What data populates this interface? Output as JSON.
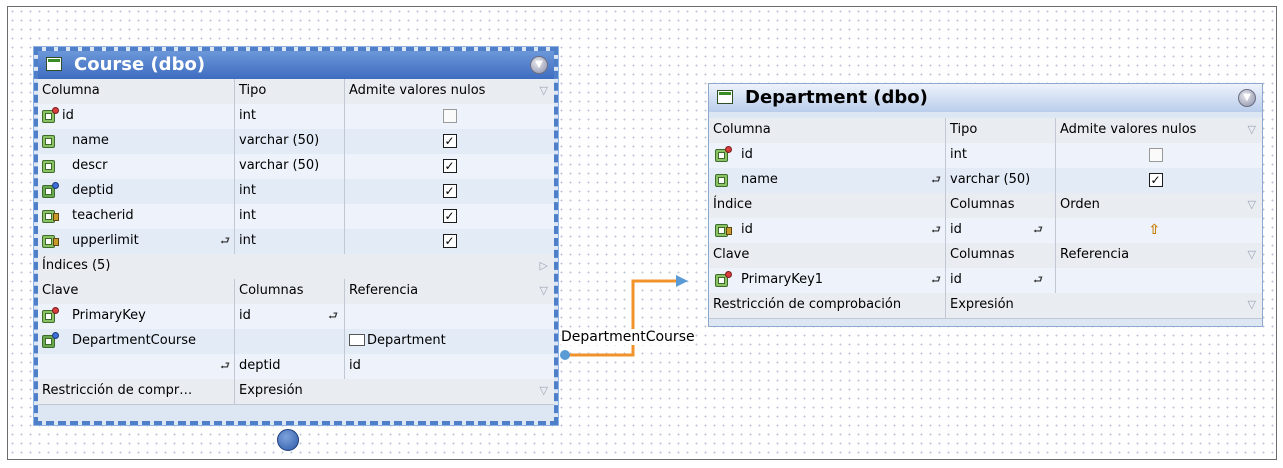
{
  "relationship": {
    "name": "DepartmentCourse"
  },
  "course": {
    "title": "Course (dbo)",
    "columns_header": {
      "col": "Columna",
      "type": "Tipo",
      "nullable": "Admite valores nulos"
    },
    "columns": [
      {
        "name": "id",
        "type": "int",
        "nullable": false,
        "key": "pk"
      },
      {
        "name": "name",
        "type": "varchar (50)",
        "nullable": true,
        "key": "none"
      },
      {
        "name": "descr",
        "type": "varchar (50)",
        "nullable": true,
        "key": "none"
      },
      {
        "name": "deptid",
        "type": "int",
        "nullable": true,
        "key": "fk"
      },
      {
        "name": "teacherid",
        "type": "int",
        "nullable": true,
        "key": "idx"
      },
      {
        "name": "upperlimit",
        "type": "int",
        "nullable": true,
        "key": "idx"
      }
    ],
    "indices_label": "Índices (5)",
    "keys_header": {
      "key": "Clave",
      "cols": "Columnas",
      "ref": "Referencia"
    },
    "keys": [
      {
        "name": "PrimaryKey",
        "cols": "id",
        "ref": ""
      },
      {
        "name": "DepartmentCourse",
        "cols": "",
        "ref": "Department"
      }
    ],
    "fk_detail": {
      "cols": "deptid",
      "ref": "id"
    },
    "check_header": {
      "label": "Restricción de compr…",
      "expr": "Expresión"
    }
  },
  "department": {
    "title": "Department (dbo)",
    "columns_header": {
      "col": "Columna",
      "type": "Tipo",
      "nullable": "Admite valores nulos"
    },
    "columns": [
      {
        "name": "id",
        "type": "int",
        "nullable": false,
        "key": "pk"
      },
      {
        "name": "name",
        "type": "varchar (50)",
        "nullable": true,
        "key": "none"
      }
    ],
    "index_header": {
      "label": "Índice",
      "cols": "Columnas",
      "order": "Orden"
    },
    "index_rows": [
      {
        "name": "id",
        "cols": "id"
      }
    ],
    "keys_header": {
      "key": "Clave",
      "cols": "Columnas",
      "ref": "Referencia"
    },
    "keys": [
      {
        "name": "PrimaryKey1",
        "cols": "id"
      }
    ],
    "check_header": {
      "label": "Restricción de comprobación",
      "expr": "Expresión"
    }
  },
  "colors": {
    "accent": "#4f7fc9",
    "connector": "#f0932b",
    "arrow": "#5b9bd5"
  }
}
